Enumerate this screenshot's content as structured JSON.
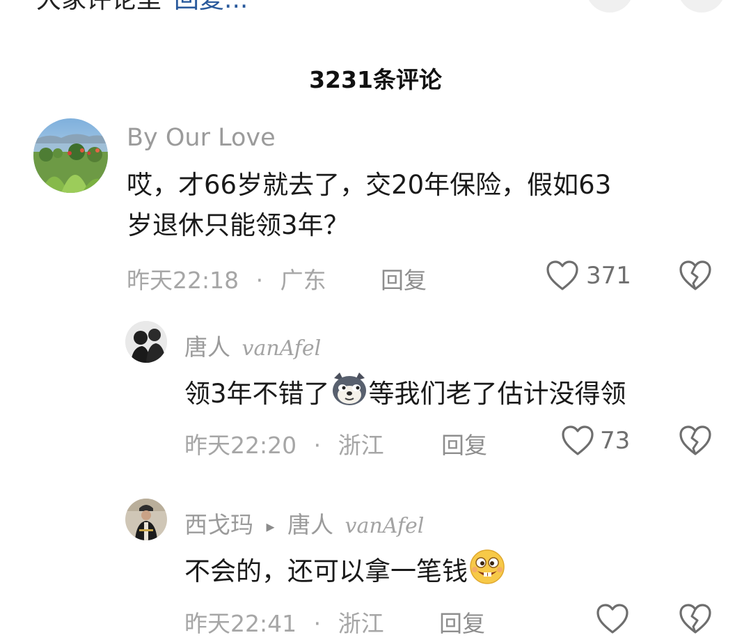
{
  "top_strip": {
    "text": "大家评论里",
    "link": "回复..."
  },
  "comments_header": {
    "count_label": "3231条评论"
  },
  "comments": [
    {
      "username": "By Our Love",
      "text_line1": "哎，才66岁就去了，交20年保险，假如63",
      "text_line2": "岁退休只能领3年？",
      "time": "昨天22:18",
      "separator": "·",
      "location": "广东",
      "reply_label": "回复",
      "likes": "371"
    },
    {
      "username": "唐人",
      "username_signature": "vanAfel",
      "text_before_emoji": "领3年不错了",
      "emoji": "doge-emoji",
      "text_after_emoji": "等我们老了估计没得领",
      "time": "昨天22:20",
      "separator": "·",
      "location": "浙江",
      "reply_label": "回复",
      "likes": "73"
    },
    {
      "username": "西戈玛",
      "reply_arrow": "▸",
      "reply_to": "唐人",
      "reply_to_signature": "vanAfel",
      "text": "不会的，还可以拿一笔钱",
      "emoji": "goofy-grin-emoji",
      "time": "昨天22:41",
      "separator": "·",
      "location": "浙江",
      "reply_label": "回复",
      "likes": ""
    }
  ],
  "icons": {
    "like": "heart-outline-icon",
    "dislike": "broken-heart-icon"
  },
  "colors": {
    "username": "#9b9b9b",
    "meta": "#a6a6a6",
    "text": "#1a1a1a",
    "icon": "#7a7a7a"
  }
}
